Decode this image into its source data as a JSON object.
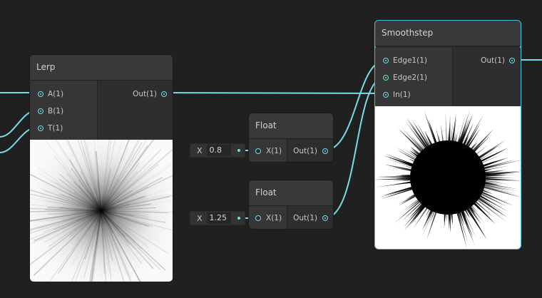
{
  "colors": {
    "background": "#202020",
    "node_body": "#2b2b2b",
    "node_header": "#393939",
    "wire": "#79dbe8",
    "selection": "#44c0dd"
  },
  "nodes": {
    "lerp": {
      "title": "Lerp",
      "inputs": [
        "A(1)",
        "B(1)",
        "T(1)"
      ],
      "output": "Out(1)"
    },
    "float1": {
      "title": "Float",
      "input": "X(1)",
      "output": "Out(1)",
      "field_label": "X",
      "field_value": "0.8"
    },
    "float2": {
      "title": "Float",
      "input": "X(1)",
      "output": "Out(1)",
      "field_label": "X",
      "field_value": "1.25"
    },
    "smoothstep": {
      "title": "Smoothstep",
      "inputs": [
        "Edge1(1)",
        "Edge2(1)",
        "In(1)"
      ],
      "output": "Out(1)"
    }
  }
}
